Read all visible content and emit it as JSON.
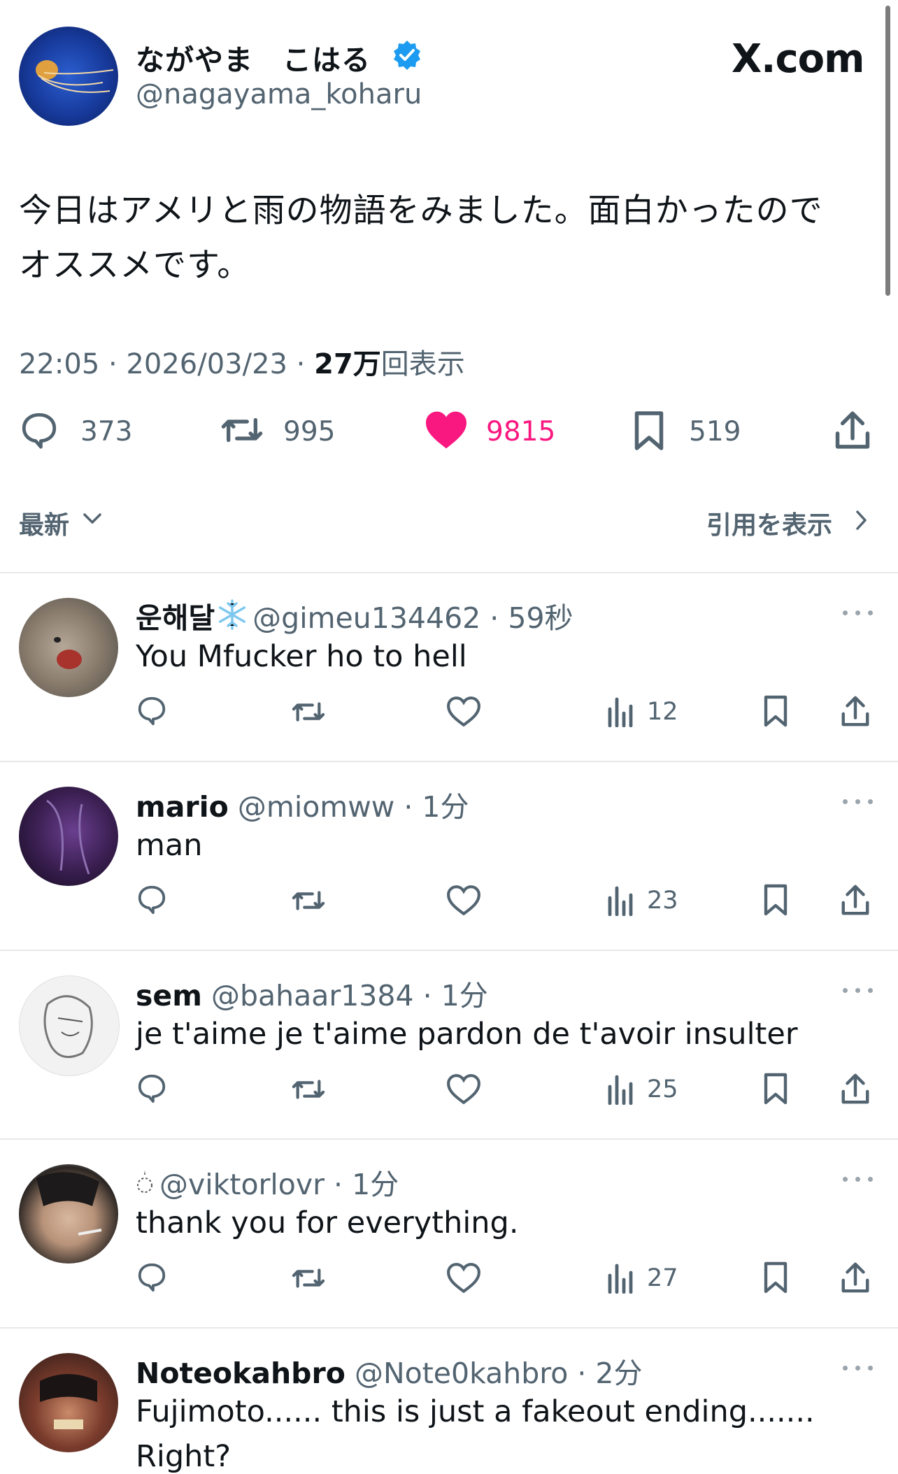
{
  "post": {
    "display_name": "ながやま　こはる",
    "handle": "@nagayama_koharu",
    "site_logo": "X.com",
    "text_line1": "今日はアメリと雨の物語をみました。面白かったので",
    "text_line2": "オススメです。",
    "time": "22:05 · 2026/03/23 · ",
    "views_count": "27万",
    "views_label": "回表示",
    "stats": {
      "replies": "373",
      "reposts": "995",
      "likes": "9815",
      "bookmarks": "519"
    },
    "like_color": "#f91880",
    "verified_color": "#1d9bf0"
  },
  "sort": {
    "label": "最新",
    "quotes_label": "引用を表示"
  },
  "replies": [
    {
      "name": "운해달",
      "name_icon": "snowflake-icon",
      "handle": "@gimeu134462",
      "time": "59秒",
      "text": "You Mfucker ho to hell",
      "views": "12"
    },
    {
      "name": "mario",
      "handle": "@miomww",
      "time": "1分",
      "text": "man",
      "views": "23"
    },
    {
      "name": "sem",
      "handle": "@bahaar1384",
      "time": "1分",
      "text": "je t'aime je t'aime pardon de t'avoir insulter",
      "views": "25"
    },
    {
      "name_icon": "sparkle-circle-icon",
      "handle": "@viktorlovr",
      "time": "1分",
      "text": "thank you for everything.",
      "views": "27"
    },
    {
      "name": "Noteokahbro",
      "handle": "@Note0kahbro",
      "time": "2分",
      "text": "Fujimoto...... this is just a fakeout ending.......",
      "text2": "Right?"
    }
  ]
}
